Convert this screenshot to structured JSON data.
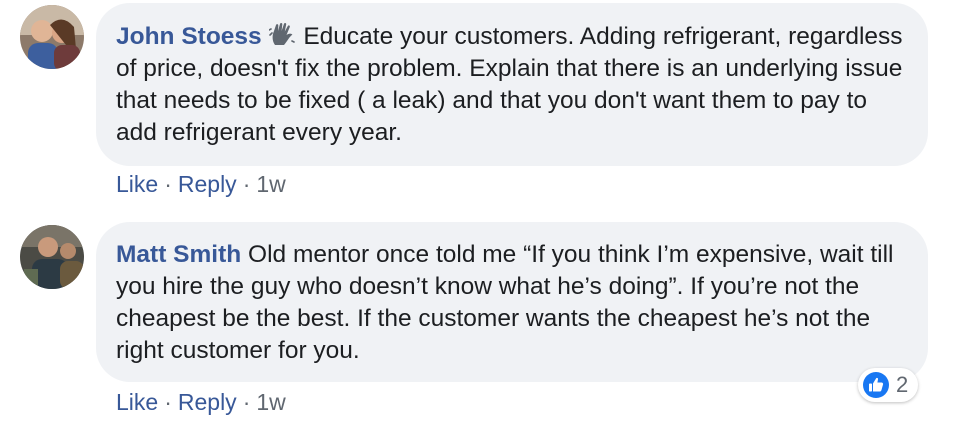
{
  "comments": [
    {
      "author": "John Stoess",
      "badge_icon": "top-fan-badge-icon",
      "text": "Educate your customers. Adding refrigerant, regardless of price, doesn't fix the problem. Explain that there is an underlying issue that needs to be fixed ( a leak) and that you don't want them to pay to add refrigerant every year.",
      "actions": {
        "like": "Like",
        "reply": "Reply",
        "time": "1w"
      }
    },
    {
      "author": "Matt Smith",
      "text": "Old mentor once told me “If you think I’m expensive, wait till you hire the guy who doesn’t know what he’s doing”. If you’re not the cheapest be the best. If the customer wants the cheapest he’s not the right customer for you.",
      "actions": {
        "like": "Like",
        "reply": "Reply",
        "time": "1w"
      },
      "reactions": {
        "icon": "thumbs-up-icon",
        "count": "2"
      }
    }
  ],
  "separator": "·",
  "colors": {
    "link": "#385898",
    "bubble": "#f0f2f5",
    "like_blue": "#1877f2"
  }
}
